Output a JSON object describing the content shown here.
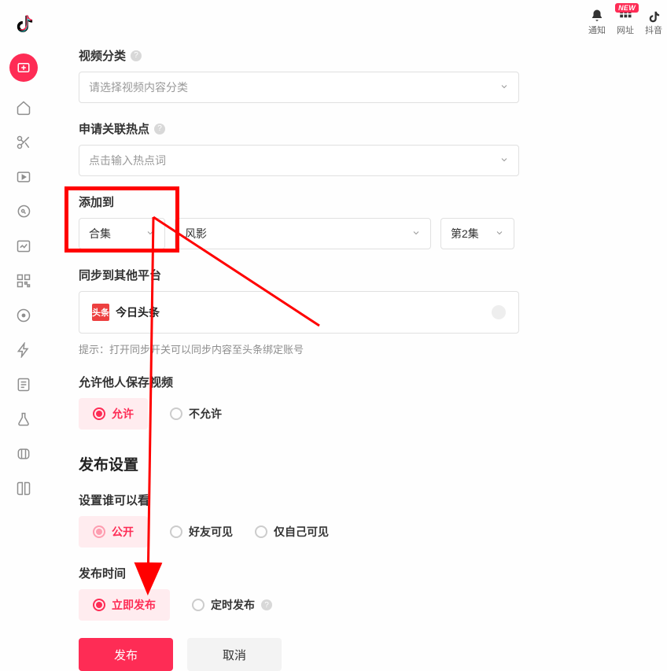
{
  "topright": {
    "notify_label": "通知",
    "urls_label": "网址",
    "urls_badge": "NEW",
    "brand_label": "抖音"
  },
  "video_category": {
    "label": "视频分类",
    "placeholder": "请选择视频内容分类"
  },
  "hot_topic": {
    "label": "申请关联热点",
    "placeholder": "点击输入热点词"
  },
  "add_to": {
    "label": "添加到",
    "collection_label": "合集",
    "series_value": "风影",
    "episode_value": "第2集"
  },
  "sync": {
    "label": "同步到其他平台",
    "toutiao_icon_text": "头条",
    "toutiao_name": "今日头条",
    "hint_prefix": "提示：",
    "hint_body": "打开同步开关可以同步内容至头条绑定账号"
  },
  "allow_save": {
    "label": "允许他人保存视频",
    "allow": "允许",
    "deny": "不允许"
  },
  "publish_settings_title": "发布设置",
  "visibility": {
    "label": "设置谁可以看",
    "public": "公开",
    "friends": "好友可见",
    "private": "仅自己可见"
  },
  "publish_time": {
    "label": "发布时间",
    "now": "立即发布",
    "scheduled": "定时发布"
  },
  "buttons": {
    "publish": "发布",
    "cancel": "取消"
  }
}
